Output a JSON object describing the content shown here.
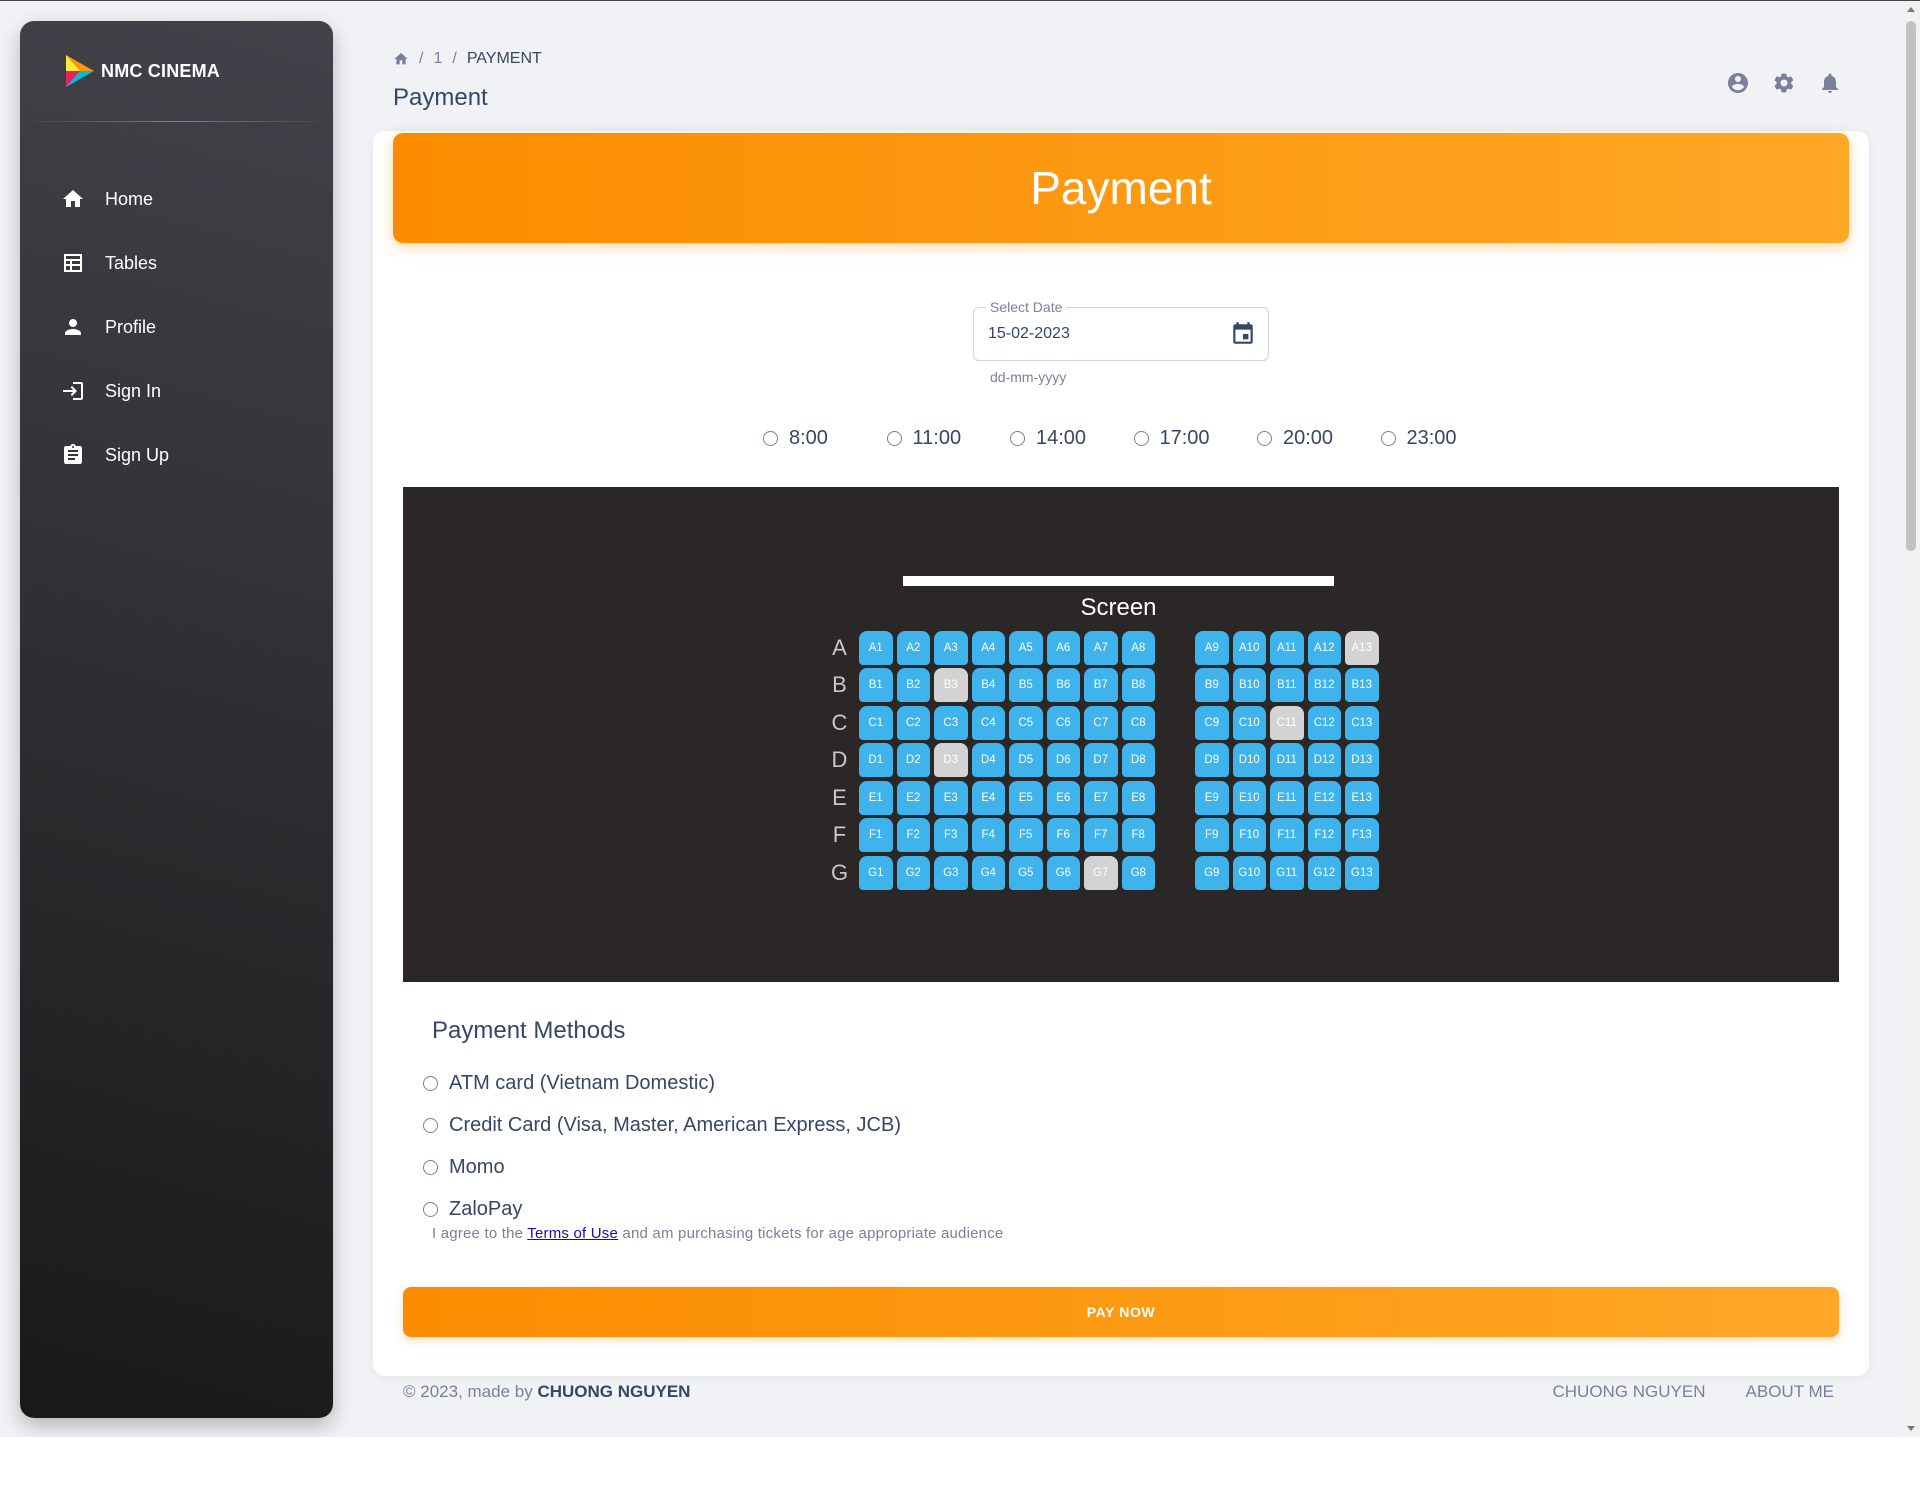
{
  "sidebar": {
    "brand": "NMC CINEMA",
    "items": [
      {
        "label": "Home",
        "icon": "home-icon"
      },
      {
        "label": "Tables",
        "icon": "table-icon"
      },
      {
        "label": "Profile",
        "icon": "person-icon"
      },
      {
        "label": "Sign In",
        "icon": "login-icon"
      },
      {
        "label": "Sign Up",
        "icon": "assignment-icon"
      }
    ]
  },
  "breadcrumb": {
    "home_icon": "home-icon",
    "middle": "1",
    "current": "PAYMENT"
  },
  "page_title": "Payment",
  "topbar_icons": [
    "account-circle-icon",
    "settings-icon",
    "notifications-icon"
  ],
  "header": {
    "title": "Payment"
  },
  "date_picker": {
    "label": "Select Date",
    "value": "15-02-2023",
    "helper": "dd-mm-yyyy"
  },
  "showtimes": [
    "8:00",
    "11:00",
    "14:00",
    "17:00",
    "20:00",
    "23:00"
  ],
  "theater": {
    "screen_label": "Screen",
    "rows": [
      "A",
      "B",
      "C",
      "D",
      "E",
      "F",
      "G"
    ],
    "left_seats": 8,
    "right_seats": 5,
    "right_start": 9,
    "taken": [
      "A13",
      "B3",
      "C11",
      "D3",
      "G7"
    ]
  },
  "payment": {
    "title": "Payment Methods",
    "methods": [
      "ATM card (Vietnam Domestic)",
      "Credit Card (Visa, Master, American Express, JCB)",
      "Momo",
      "ZaloPay"
    ],
    "terms_prefix": "I agree to the ",
    "terms_link": "Terms of Use",
    "terms_suffix": " and am purchasing tickets for age appropriate audience",
    "pay_button": "PAY NOW"
  },
  "footer": {
    "copyright": "© 2023, made by ",
    "author": "CHUONG NGUYEN",
    "links": [
      "CHUONG NGUYEN",
      "ABOUT ME"
    ]
  },
  "colors": {
    "accent": "#fb8c00",
    "seat_available": "#3eb3ec",
    "seat_taken": "#d3d3d3"
  }
}
